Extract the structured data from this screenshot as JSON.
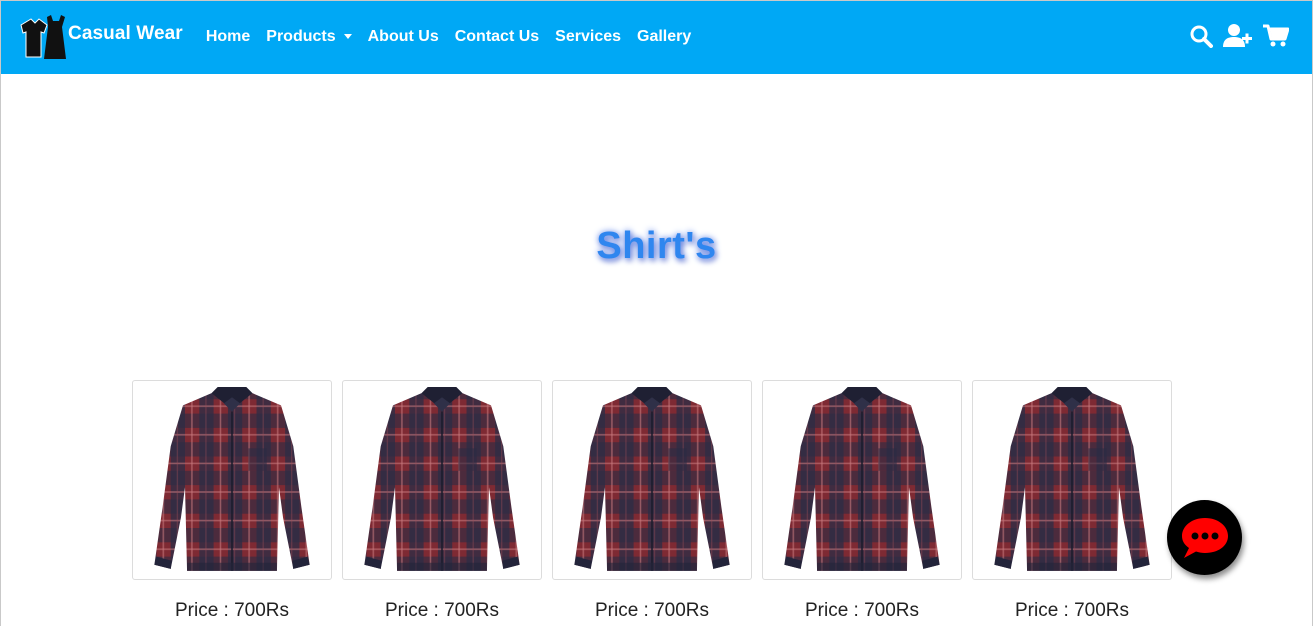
{
  "navbar": {
    "brand": "Casual Wear",
    "logo_icon": "tshirt-dress-logo-icon",
    "links": [
      {
        "label": "Home"
      },
      {
        "label": "Products",
        "dropdown": true
      },
      {
        "label": "About Us"
      },
      {
        "label": "Contact Us"
      },
      {
        "label": "Services"
      },
      {
        "label": "Gallery"
      }
    ],
    "icons": [
      "search-icon",
      "user-plus-icon",
      "cart-icon"
    ],
    "background_color": "#00a8f5"
  },
  "page": {
    "title": "Shirt's",
    "title_color": "#2f86ef"
  },
  "products": [
    {
      "image": "red-plaid-shirt",
      "price": "Price : 700Rs"
    },
    {
      "image": "red-plaid-shirt",
      "price": "Price : 700Rs"
    },
    {
      "image": "red-plaid-shirt",
      "price": "Price : 700Rs"
    },
    {
      "image": "red-plaid-shirt",
      "price": "Price : 700Rs"
    },
    {
      "image": "red-plaid-shirt",
      "price": "Price : 700Rs"
    }
  ],
  "chat_button": {
    "icon": "chat-bubble-icon",
    "color": "#ff0000"
  }
}
